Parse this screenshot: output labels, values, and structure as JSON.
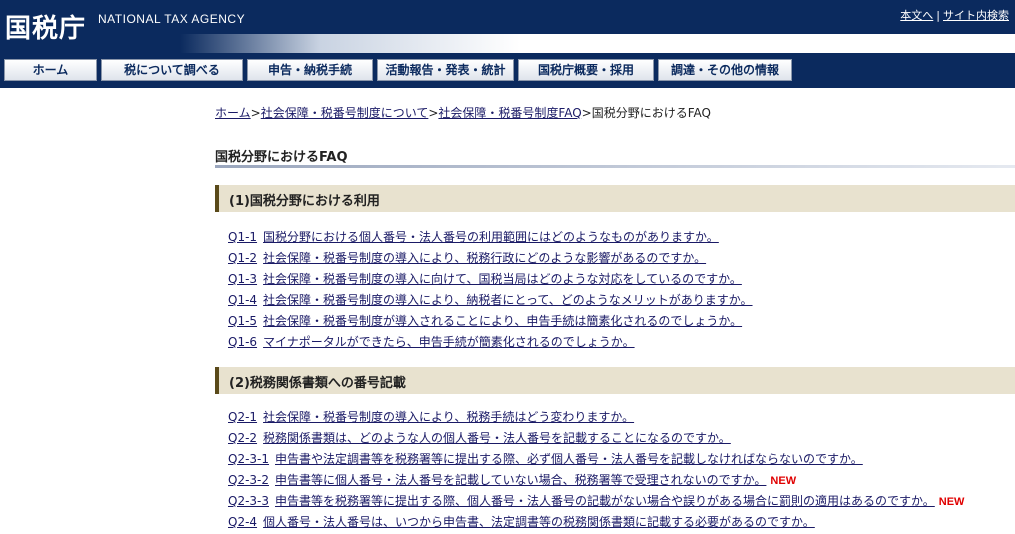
{
  "header": {
    "logo": "国税庁",
    "logo_en": "NATIONAL TAX AGENCY",
    "util_links": [
      "本文へ",
      "サイト内検索"
    ],
    "util_sep": "|"
  },
  "nav": {
    "items": [
      "ホーム",
      "税について調べる",
      "申告・納税手続",
      "活動報告・発表・統計",
      "国税庁概要・採用",
      "調達・その他の情報"
    ]
  },
  "breadcrumb": {
    "items": [
      "ホーム",
      "社会保障・税番号制度について",
      "社会保障・税番号制度FAQ",
      "国税分野におけるFAQ"
    ],
    "sep": ">"
  },
  "page": {
    "title": "国税分野におけるFAQ"
  },
  "sections": [
    {
      "title": "(1)国税分野における利用",
      "items": [
        {
          "id": "Q1-1",
          "text": "国税分野における個人番号・法人番号の利用範囲にはどのようなものがありますか。",
          "new": ""
        },
        {
          "id": "Q1-2",
          "text": "社会保障・税番号制度の導入により、税務行政にどのような影響があるのですか。",
          "new": ""
        },
        {
          "id": "Q1-3",
          "text": "社会保障・税番号制度の導入に向けて、国税当局はどのような対応をしているのですか。",
          "new": ""
        },
        {
          "id": "Q1-4",
          "text": "社会保障・税番号制度の導入により、納税者にとって、どのようなメリットがありますか。",
          "new": ""
        },
        {
          "id": "Q1-5",
          "text": "社会保障・税番号制度が導入されることにより、申告手続は簡素化されるのでしょうか。",
          "new": ""
        },
        {
          "id": "Q1-6",
          "text": "マイナポータルができたら、申告手続が簡素化されるのでしょうか。",
          "new": ""
        }
      ]
    },
    {
      "title": "(2)税務関係書類への番号記載",
      "items": [
        {
          "id": "Q2-1",
          "text": "社会保障・税番号制度の導入により、税務手続はどう変わりますか。",
          "new": ""
        },
        {
          "id": "Q2-2",
          "text": "税務関係書類は、どのような人の個人番号・法人番号を記載することになるのですか。",
          "new": ""
        },
        {
          "id": "Q2-3-1",
          "text": "申告書や法定調書等を税務署等に提出する際、必ず個人番号・法人番号を記載しなければならないのですか。",
          "new": ""
        },
        {
          "id": "Q2-3-2",
          "text": "申告書等に個人番号・法人番号を記載していない場合、税務署等で受理されないのですか。",
          "new": "NEW"
        },
        {
          "id": "Q2-3-3",
          "text": "申告書等を税務署等に提出する際、個人番号・法人番号の記載がない場合や誤りがある場合に罰則の適用はあるのですか。",
          "new": "NEW"
        },
        {
          "id": "Q2-4",
          "text": "個人番号・法人番号は、いつから申告書、法定調書等の税務関係書類に記載する必要があるのですか。",
          "new": ""
        }
      ]
    }
  ]
}
